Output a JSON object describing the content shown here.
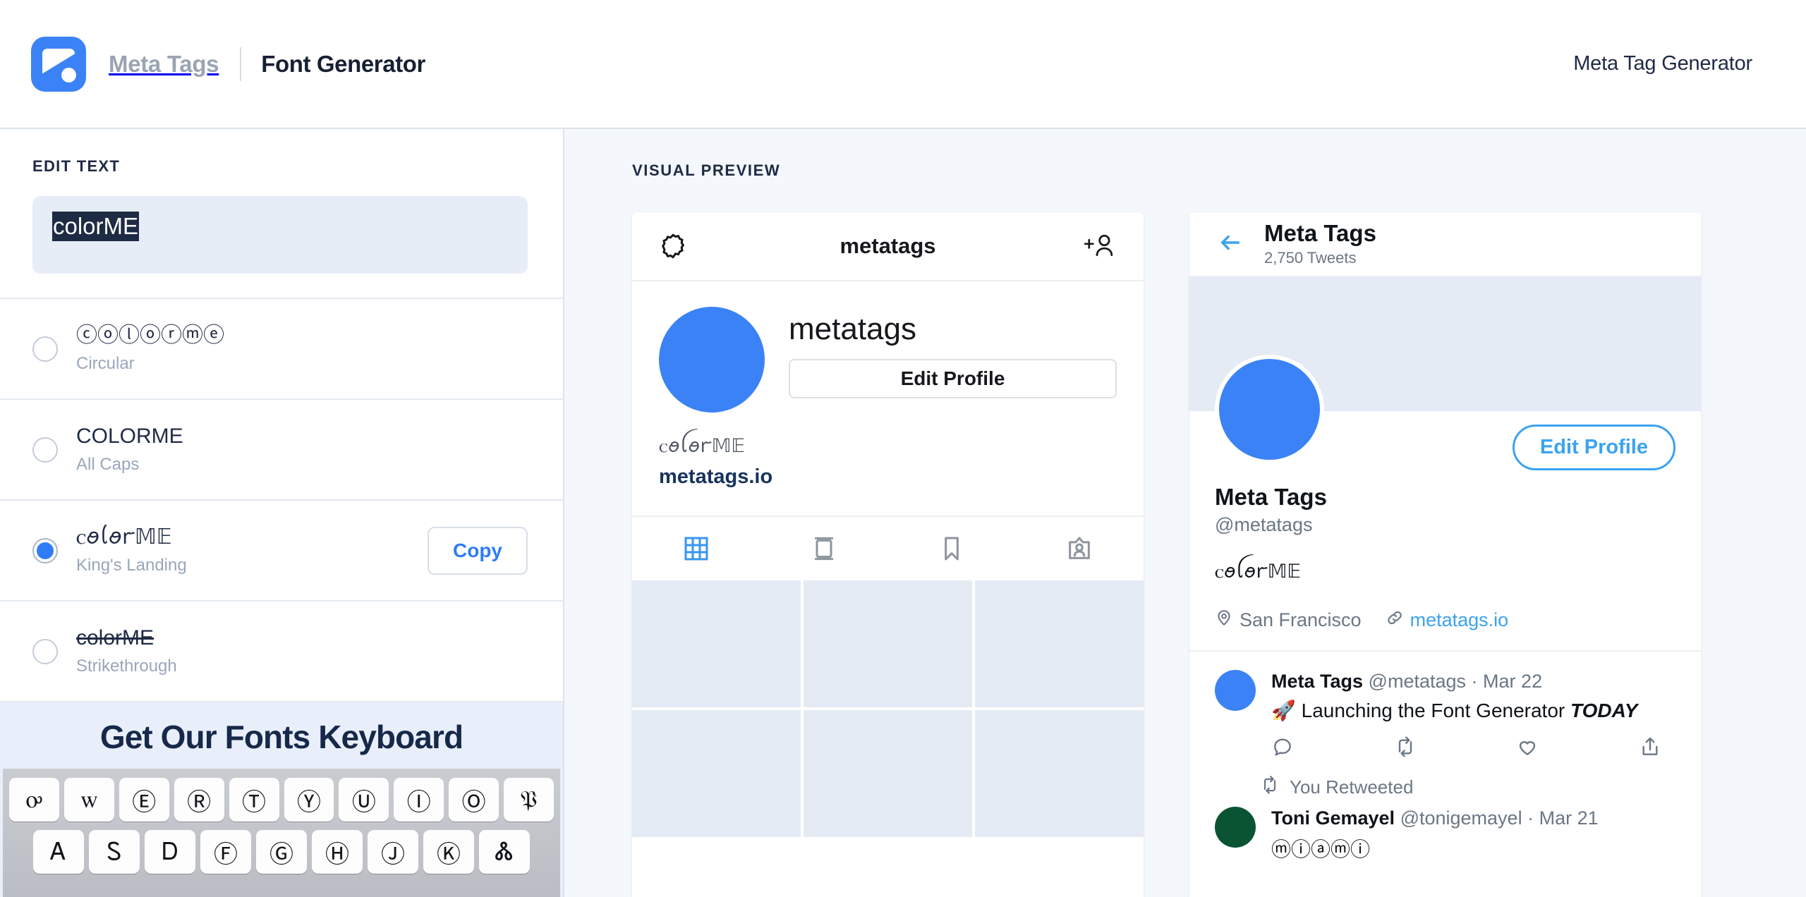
{
  "header": {
    "brand_meta": "Meta Tags",
    "brand_title": "Font Generator",
    "right_link": "Meta Tag Generator"
  },
  "sidebar": {
    "edit_label": "EDIT TEXT",
    "input_value": "colorME",
    "font_options": [
      {
        "sample": "ⓒⓞⓛⓞⓡⓜⓔ",
        "name": "Circular",
        "selected": false,
        "strike": false
      },
      {
        "sample": "COLORME",
        "name": "All Caps",
        "selected": false,
        "strike": false
      },
      {
        "sample": "ꮯꪮꪶꪮꭈ𝕄𝔼",
        "name": "King's Landing",
        "selected": true,
        "strike": false,
        "copy_label": "Copy"
      },
      {
        "sample": "colorME",
        "name": "Strikethrough",
        "selected": false,
        "strike": true
      }
    ],
    "promo_title": "Get Our Fonts Keyboard",
    "keyboard_row1": [
      "ꭴ",
      "ꮃ",
      "Ⓔ",
      "Ⓡ",
      "Ⓣ",
      "Ⓨ",
      "Ⓤ",
      "Ⓘ",
      "Ⓞ",
      "𝔓"
    ],
    "keyboard_row2": [
      "Ꭺ",
      "Ꮪ",
      "Ꭰ",
      "Ⓕ",
      "Ⓖ",
      "Ⓗ",
      "Ⓙ",
      "Ⓚ",
      "Ꮬ"
    ]
  },
  "preview": {
    "label": "VISUAL PREVIEW",
    "instagram": {
      "header_title": "metatags",
      "display_name": "metatags",
      "edit_button": "Edit Profile",
      "bio": "ꮯꪮꪶꪮꭈ𝕄𝔼",
      "website": "metatags.io",
      "grid_cells": 6
    },
    "twitter": {
      "header_name": "Meta Tags",
      "header_tweets": "2,750 Tweets",
      "edit_button": "Edit Profile",
      "display_name": "Meta Tags",
      "handle": "@metatags",
      "bio": "ꮯꪮꪶꪮꭈ𝕄𝔼",
      "location": "San Francisco",
      "link": "metatags.io",
      "tweets": [
        {
          "author": "Meta Tags",
          "handle": "@metatags",
          "date": "Mar 22",
          "text": "🚀 Launching the Font Generator ",
          "text_italic": "TODAY"
        },
        {
          "retweet_label": "You Retweeted",
          "author": "Toni Gemayel",
          "handle": "@tonigemayel",
          "date": "Mar 21",
          "text": "ⓜⓘⓐⓜⓘ"
        }
      ]
    }
  },
  "colors": {
    "brand_blue": "#3b82f6",
    "accent_blue": "#2f7df6",
    "twitter_blue": "#3ba3f0",
    "dark_navy": "#1f2a44",
    "muted": "#9aa7ba",
    "panel_bg": "#f4f7fb",
    "promo_bg": "#e9effa",
    "input_bg": "#e6edf7",
    "selection_bg": "#1d2b44"
  }
}
